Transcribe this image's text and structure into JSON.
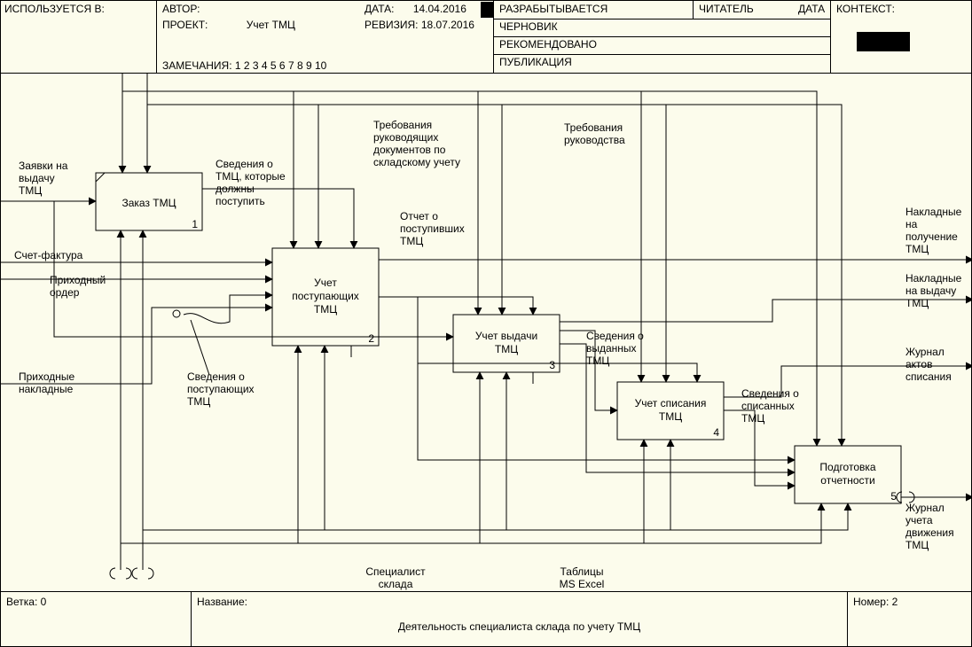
{
  "header": {
    "used_in_label": "ИСПОЛЬЗУЕТСЯ В:",
    "author_label": "АВТОР:",
    "project_label": "ПРОЕКТ:",
    "project_value": "Учет ТМЦ",
    "date_label": "ДАТА:",
    "date_value": "14.04.2016",
    "revision_label": "РЕВИЗИЯ:",
    "revision_value": "18.07.2016",
    "notes_label": "ЗАМЕЧАНИЯ:",
    "notes_value": "1 2 3 4 5 6 7 8 9 10",
    "status_developing": "РАЗРАБЫТЫВАЕТСЯ",
    "status_draft": "ЧЕРНОВИК",
    "status_rec": "РЕКОМЕНДОВАНО",
    "status_pub": "ПУБЛИКАЦИЯ",
    "reader_label": "ЧИТАТЕЛЬ",
    "reader_date_label": "ДАТА",
    "context_label": "КОНТЕКСТ:"
  },
  "boxes": {
    "b1": {
      "title": "Заказ ТМЦ",
      "num": "1"
    },
    "b2": {
      "title_l1": "Учет",
      "title_l2": "поступающих",
      "title_l3": "ТМЦ",
      "num": "2"
    },
    "b3": {
      "title_l1": "Учет выдачи",
      "title_l2": "ТМЦ",
      "num": "3"
    },
    "b4": {
      "title_l1": "Учет списания",
      "title_l2": "ТМЦ",
      "num": "4"
    },
    "b5": {
      "title_l1": "Подготовка",
      "title_l2": "отчетности",
      "num": "5"
    }
  },
  "labels": {
    "in_zayavki_l1": "Заявки на",
    "in_zayavki_l2": "выдачу",
    "in_zayavki_l3": "ТМЦ",
    "in_schet": "Счет-фактура",
    "in_prih_order_l1": "Приходный",
    "in_prih_order_l2": "ордер",
    "in_prih_nakl_l1": "Приходные",
    "in_prih_nakl_l2": "накладные",
    "sved_post_l1": "Сведения о",
    "sved_post_l2": "поступающих",
    "sved_post_l3": "ТМЦ",
    "sved_dolzhny_l1": "Сведения о",
    "sved_dolzhny_l2": "ТМЦ, которые",
    "sved_dolzhny_l3": "должны",
    "sved_dolzhny_l4": "поступить",
    "treb_ruk_doc_l1": "Требования",
    "treb_ruk_doc_l2": "руководящих",
    "treb_ruk_doc_l3": "документов по",
    "treb_ruk_doc_l4": "складскому учету",
    "otchet_post_l1": "Отчет о",
    "otchet_post_l2": "поступивших",
    "otchet_post_l3": "ТМЦ",
    "treb_ruk_l1": "Требования",
    "treb_ruk_l2": "руководства",
    "sved_vyd_l1": "Сведения о",
    "sved_vyd_l2": "выданных",
    "sved_vyd_l3": "ТМЦ",
    "sved_spis_l1": "Сведения о",
    "sved_spis_l2": "списанных",
    "sved_spis_l3": "ТМЦ",
    "out_nakl_pol_l1": "Накладные",
    "out_nakl_pol_l2": "на",
    "out_nakl_pol_l3": "получение",
    "out_nakl_pol_l4": "ТМЦ",
    "out_nakl_vyd_l1": "Накладные",
    "out_nakl_vyd_l2": "на выдачу",
    "out_nakl_vyd_l3": "ТМЦ",
    "out_zhurnal_akt_l1": "Журнал",
    "out_zhurnal_akt_l2": "актов",
    "out_zhurnal_akt_l3": "списания",
    "out_zhurnal_dv_l1": "Журнал",
    "out_zhurnal_dv_l2": "учета",
    "out_zhurnal_dv_l3": "движения",
    "out_zhurnal_dv_l4": "ТМЦ",
    "mech_spec_l1": "Специалист",
    "mech_spec_l2": "склада",
    "mech_excel_l1": "Таблицы",
    "mech_excel_l2": "MS Excel"
  },
  "footer": {
    "branch_label": "Ветка:",
    "branch_value": "0",
    "title_label": "Название:",
    "title_value": "Деятельность специалиста склада по учету ТМЦ",
    "number_label": "Номер:",
    "number_value": "2"
  }
}
